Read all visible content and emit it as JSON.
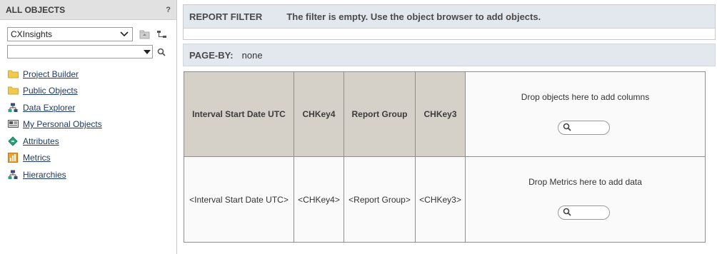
{
  "left_panel": {
    "title": "ALL OBJECTS",
    "help_label": "?",
    "project": {
      "selected": "CXInsights"
    },
    "search": {
      "value": ""
    },
    "items": [
      {
        "label": "Project Builder",
        "icon": "folder-icon"
      },
      {
        "label": "Public Objects",
        "icon": "folder-icon"
      },
      {
        "label": "Data Explorer",
        "icon": "hierarchy-icon"
      },
      {
        "label": "My Personal Objects",
        "icon": "personal-objects-icon"
      },
      {
        "label": "Attributes",
        "icon": "attribute-icon"
      },
      {
        "label": "Metrics",
        "icon": "metric-icon"
      },
      {
        "label": "Hierarchies",
        "icon": "hierarchy-icon"
      }
    ]
  },
  "report_filter": {
    "label": "REPORT FILTER",
    "message": "The filter is empty. Use the object browser to add objects."
  },
  "page_by": {
    "label": "PAGE-BY:",
    "value": "none"
  },
  "grid": {
    "headers": [
      "Interval Start Date UTC",
      "CHKey4",
      "Report Group",
      "CHKey3"
    ],
    "values": [
      "<Interval Start Date UTC>",
      "<CHKey4>",
      "<Report Group>",
      "<CHKey3>"
    ],
    "drop_columns": "Drop objects here to add columns",
    "drop_metrics": "Drop Metrics here to add data"
  },
  "colors": {
    "header_bg": "#d6d1c8",
    "filter_bar_bg": "#e3e8ee",
    "left_header_bg": "#e1e1e1",
    "link_color": "#1f3a63",
    "folder_color": "#f2c94c"
  }
}
